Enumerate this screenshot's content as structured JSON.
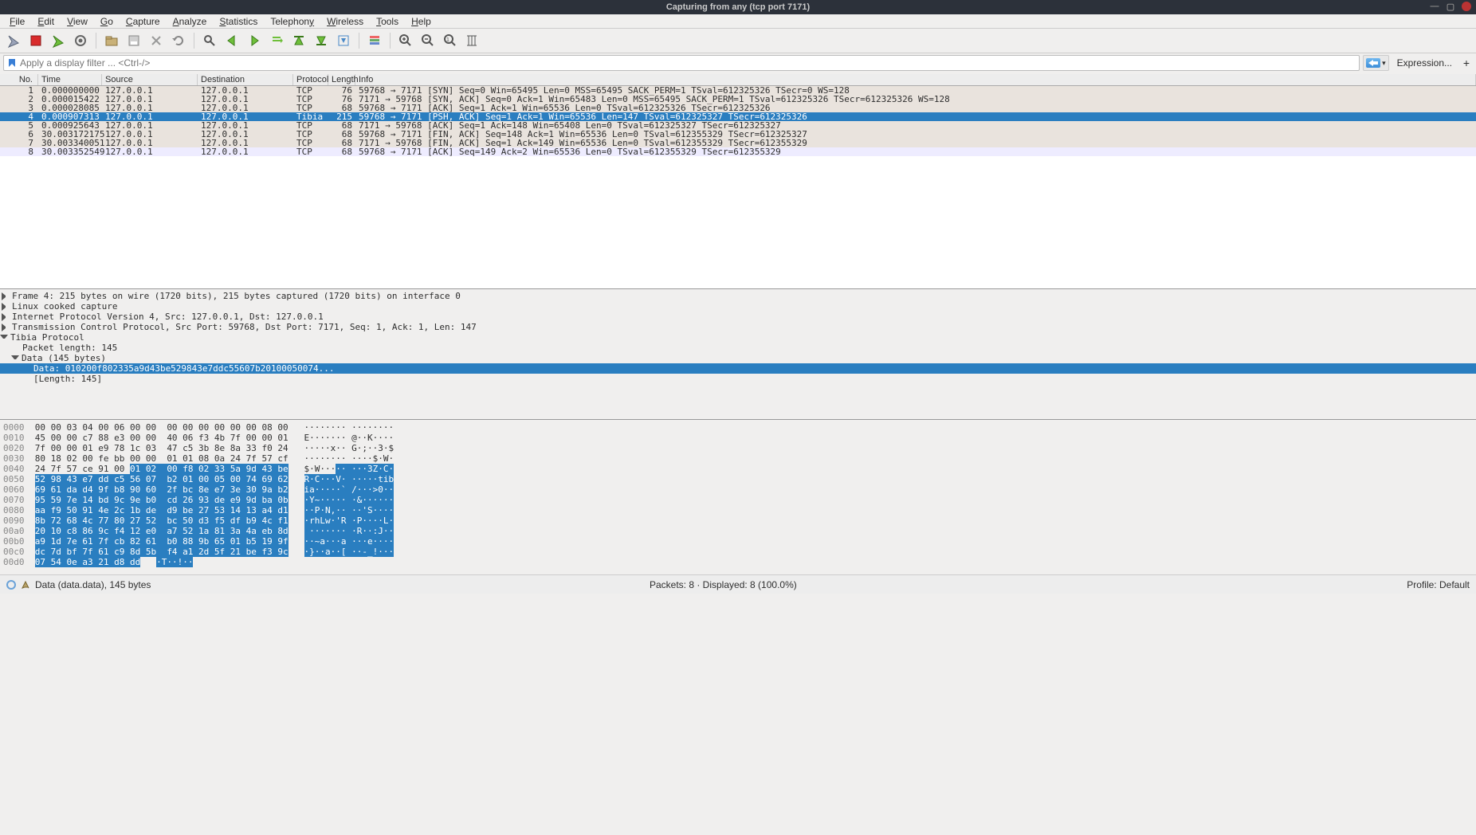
{
  "window": {
    "title": "Capturing from any (tcp port 7171)"
  },
  "menu": {
    "file": "File",
    "edit": "Edit",
    "view": "View",
    "go": "Go",
    "capture": "Capture",
    "analyze": "Analyze",
    "statistics": "Statistics",
    "telephony": "Telephony",
    "wireless": "Wireless",
    "tools": "Tools",
    "help": "Help"
  },
  "filter": {
    "placeholder": "Apply a display filter ... <Ctrl-/>",
    "expression": "Expression...",
    "plus": "+"
  },
  "columns": {
    "no": "No.",
    "time": "Time",
    "source": "Source",
    "destination": "Destination",
    "protocol": "Protocol",
    "length": "Length",
    "info": "Info"
  },
  "packets": [
    {
      "no": "1",
      "time": "0.000000000",
      "src": "127.0.0.1",
      "dst": "127.0.0.1",
      "proto": "TCP",
      "len": "76",
      "info": "59768 → 7171 [SYN] Seq=0 Win=65495 Len=0 MSS=65495 SACK_PERM=1 TSval=612325326 TSecr=0 WS=128",
      "cls": "grey"
    },
    {
      "no": "2",
      "time": "0.000015422",
      "src": "127.0.0.1",
      "dst": "127.0.0.1",
      "proto": "TCP",
      "len": "76",
      "info": "7171 → 59768 [SYN, ACK] Seq=0 Ack=1 Win=65483 Len=0 MSS=65495 SACK_PERM=1 TSval=612325326 TSecr=612325326 WS=128",
      "cls": "grey"
    },
    {
      "no": "3",
      "time": "0.000028085",
      "src": "127.0.0.1",
      "dst": "127.0.0.1",
      "proto": "TCP",
      "len": "68",
      "info": "59768 → 7171 [ACK] Seq=1 Ack=1 Win=65536 Len=0 TSval=612325326 TSecr=612325326",
      "cls": "grey"
    },
    {
      "no": "4",
      "time": "0.000907313",
      "src": "127.0.0.1",
      "dst": "127.0.0.1",
      "proto": "Tibia",
      "len": "215",
      "info": "59768 → 7171 [PSH, ACK] Seq=1 Ack=1 Win=65536 Len=147 TSval=612325327 TSecr=612325326",
      "cls": "sel"
    },
    {
      "no": "5",
      "time": "0.000925643",
      "src": "127.0.0.1",
      "dst": "127.0.0.1",
      "proto": "TCP",
      "len": "68",
      "info": "7171 → 59768 [ACK] Seq=1 Ack=148 Win=65408 Len=0 TSval=612325327 TSecr=612325327",
      "cls": "grey"
    },
    {
      "no": "6",
      "time": "30.003172175",
      "src": "127.0.0.1",
      "dst": "127.0.0.1",
      "proto": "TCP",
      "len": "68",
      "info": "59768 → 7171 [FIN, ACK] Seq=148 Ack=1 Win=65536 Len=0 TSval=612355329 TSecr=612325327",
      "cls": "grey"
    },
    {
      "no": "7",
      "time": "30.003340051",
      "src": "127.0.0.1",
      "dst": "127.0.0.1",
      "proto": "TCP",
      "len": "68",
      "info": "7171 → 59768 [FIN, ACK] Seq=1 Ack=149 Win=65536 Len=0 TSval=612355329 TSecr=612355329",
      "cls": "grey"
    },
    {
      "no": "8",
      "time": "30.003352549",
      "src": "127.0.0.1",
      "dst": "127.0.0.1",
      "proto": "TCP",
      "len": "68",
      "info": "59768 → 7171 [ACK] Seq=149 Ack=2 Win=65536 Len=0 TSval=612355329 TSecr=612355329",
      "cls": "light"
    }
  ],
  "details": {
    "l0": "Frame 4: 215 bytes on wire (1720 bits), 215 bytes captured (1720 bits) on interface 0",
    "l1": "Linux cooked capture",
    "l2": "Internet Protocol Version 4, Src: 127.0.0.1, Dst: 127.0.0.1",
    "l3": "Transmission Control Protocol, Src Port: 59768, Dst Port: 7171, Seq: 1, Ack: 1, Len: 147",
    "l4": "Tibia Protocol",
    "l5": "Packet length: 145",
    "l6": "Data (145 bytes)",
    "l7": "Data: 010200f802335a9d43be529843e7ddc55607b20100050074...",
    "l8": "[Length: 145]"
  },
  "hex": [
    {
      "off": "0000",
      "h1": "00 00 03 04 00 06 00 00",
      "h2": "00 00 00 00 00 00 08 00",
      "a": "········ ········",
      "hi": 0
    },
    {
      "off": "0010",
      "h1": "45 00 00 c7 88 e3 00 00",
      "h2": "40 06 f3 4b 7f 00 00 01",
      "a": "E······· @··K····",
      "hi": 0
    },
    {
      "off": "0020",
      "h1": "7f 00 00 01 e9 78 1c 03",
      "h2": "47 c5 3b 8e 8a 33 f0 24",
      "a": "·····x·· G·;··3·$",
      "hi": 0
    },
    {
      "off": "0030",
      "h1": "80 18 02 00 fe bb 00 00",
      "h2": "01 01 08 0a 24 7f 57 cf",
      "a": "········ ····$·W·",
      "hi": 0
    },
    {
      "off": "0040",
      "h1": "24 7f 57 ce 91 00 01 02",
      "h2": "00 f8 02 33 5a 9d 43 be",
      "a": "$·W····· ···3Z·C·",
      "hi": 1,
      "hiStartH": 6,
      "hiStartA": 6
    },
    {
      "off": "0050",
      "h1": "52 98 43 e7 dd c5 56 07",
      "h2": "b2 01 00 05 00 74 69 62",
      "a": "R·C···V· ·····tib",
      "hi": 2
    },
    {
      "off": "0060",
      "h1": "69 61 da d4 9f b8 90 60",
      "h2": "2f bc 8e e7 3e 30 9a b2",
      "a": "ia·····` /···>0··",
      "hi": 2
    },
    {
      "off": "0070",
      "h1": "95 59 7e 14 bd 9c 9e b0",
      "h2": "cd 26 93 de e9 9d ba 0b",
      "a": "·Y~····· ·&······",
      "hi": 2
    },
    {
      "off": "0080",
      "h1": "aa f9 50 91 4e 2c 1b de",
      "h2": "d9 be 27 53 14 13 a4 d1",
      "a": "··P·N,·· ··'S····",
      "hi": 2
    },
    {
      "off": "0090",
      "h1": "8b 72 68 4c 77 80 27 52",
      "h2": "bc 50 d3 f5 df b9 4c f1",
      "a": "·rhLw·'R ·P····L·",
      "hi": 2
    },
    {
      "off": "00a0",
      "h1": "20 10 c8 86 9c f4 12 e0",
      "h2": "a7 52 1a 81 3a 4a eb 8d",
      "a": " ······· ·R··:J··",
      "hi": 2
    },
    {
      "off": "00b0",
      "h1": "a9 1d 7e 61 7f cb 82 61",
      "h2": "b0 88 9b 65 01 b5 19 9f",
      "a": "··~a···a ···e····",
      "hi": 2
    },
    {
      "off": "00c0",
      "h1": "dc 7d bf 7f 61 c9 8d 5b",
      "h2": "f4 a1 2d 5f 21 be f3 9c",
      "a": "·}··a··[ ··-_!···",
      "hi": 2
    },
    {
      "off": "00d0",
      "h1": "07 54 0e a3 21 d8 dd",
      "h2": "",
      "a": "·T··!··",
      "hi": 2
    }
  ],
  "status": {
    "left": "Data (data.data), 145 bytes",
    "center": "Packets: 8 · Displayed: 8 (100.0%)",
    "right": "Profile: Default"
  }
}
